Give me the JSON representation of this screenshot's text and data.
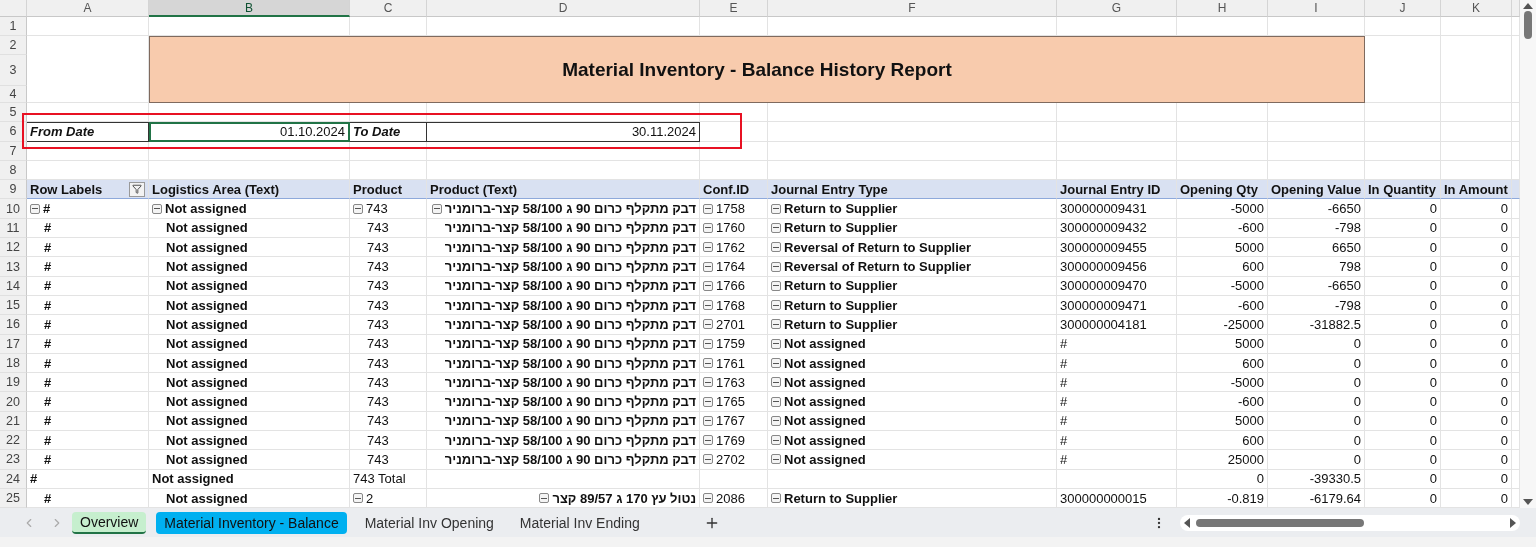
{
  "columns": [
    {
      "label": "A",
      "selected": false
    },
    {
      "label": "B",
      "selected": true
    },
    {
      "label": "C",
      "selected": false
    },
    {
      "label": "D",
      "selected": false
    },
    {
      "label": "E",
      "selected": false
    },
    {
      "label": "F",
      "selected": false
    },
    {
      "label": "G",
      "selected": false
    },
    {
      "label": "H",
      "selected": false
    },
    {
      "label": "I",
      "selected": false
    },
    {
      "label": "J",
      "selected": false
    },
    {
      "label": "K",
      "selected": false
    }
  ],
  "top_row_numbers": [
    "1",
    "2",
    "3",
    "4",
    "5",
    "6",
    "7",
    "8"
  ],
  "title": "Material Inventory - Balance History Report",
  "date_filter": {
    "highlighted": true,
    "from_label": "From Date",
    "from_value": "01.10.2024",
    "from_selected": true,
    "to_label": "To Date",
    "to_value": "30.11.2024"
  },
  "pivot": {
    "header_row_number": "9",
    "headers": [
      "Row Labels",
      "Logistics Area (Text)",
      "Product",
      "Product (Text)",
      "Conf.ID",
      "Journal Entry Type",
      "Journal Entry ID",
      "Opening Qty",
      "Opening Value",
      "In Quantity",
      "In Amount"
    ],
    "rows": [
      {
        "num": "10",
        "kind": "detail",
        "cells": [
          {
            "text": "#",
            "expanded": true
          },
          {
            "text": "Not assigned",
            "expanded": true
          },
          {
            "text": "743",
            "expanded": true
          },
          {
            "text": "דבק מתקלף כרום 90 ג 58/100 קצר-ברומניר",
            "expanded": true
          },
          {
            "text": "1758",
            "expanded": true
          },
          {
            "text": "Return to Supplier",
            "expanded": true
          },
          "300000009431",
          "-5000",
          "-6650",
          "0",
          "0"
        ]
      },
      {
        "num": "11",
        "kind": "detail",
        "cells": [
          "#",
          "Not assigned",
          "743",
          "דבק מתקלף כרום 90 ג 58/100 קצר-ברומניר",
          {
            "text": "1760",
            "expanded": true
          },
          {
            "text": "Return to Supplier",
            "expanded": true
          },
          "300000009432",
          "-600",
          "-798",
          "0",
          "0"
        ]
      },
      {
        "num": "12",
        "kind": "detail",
        "cells": [
          "#",
          "Not assigned",
          "743",
          "דבק מתקלף כרום 90 ג 58/100 קצר-ברומניר",
          {
            "text": "1762",
            "expanded": true
          },
          {
            "text": "Reversal of Return to Supplier",
            "expanded": true
          },
          "300000009455",
          "5000",
          "6650",
          "0",
          "0"
        ]
      },
      {
        "num": "13",
        "kind": "detail",
        "cells": [
          "#",
          "Not assigned",
          "743",
          "דבק מתקלף כרום 90 ג 58/100 קצר-ברומניר",
          {
            "text": "1764",
            "expanded": true
          },
          {
            "text": "Reversal of Return to Supplier",
            "expanded": true
          },
          "300000009456",
          "600",
          "798",
          "0",
          "0"
        ]
      },
      {
        "num": "14",
        "kind": "detail",
        "cells": [
          "#",
          "Not assigned",
          "743",
          "דבק מתקלף כרום 90 ג 58/100 קצר-ברומניר",
          {
            "text": "1766",
            "expanded": true
          },
          {
            "text": "Return to Supplier",
            "expanded": true
          },
          "300000009470",
          "-5000",
          "-6650",
          "0",
          "0"
        ]
      },
      {
        "num": "15",
        "kind": "detail",
        "cells": [
          "#",
          "Not assigned",
          "743",
          "דבק מתקלף כרום 90 ג 58/100 קצר-ברומניר",
          {
            "text": "1768",
            "expanded": true
          },
          {
            "text": "Return to Supplier",
            "expanded": true
          },
          "300000009471",
          "-600",
          "-798",
          "0",
          "0"
        ]
      },
      {
        "num": "16",
        "kind": "detail",
        "cells": [
          "#",
          "Not assigned",
          "743",
          "דבק מתקלף כרום 90 ג 58/100 קצר-ברומניר",
          {
            "text": "2701",
            "expanded": true
          },
          {
            "text": "Return to Supplier",
            "expanded": true
          },
          "300000004181",
          "-25000",
          "-31882.5",
          "0",
          "0"
        ]
      },
      {
        "num": "17",
        "kind": "detail",
        "cells": [
          "#",
          "Not assigned",
          "743",
          "דבק מתקלף כרום 90 ג 58/100 קצר-ברומניר",
          {
            "text": "1759",
            "expanded": true
          },
          {
            "text": "Not assigned",
            "expanded": true
          },
          "#",
          "5000",
          "0",
          "0",
          "0"
        ]
      },
      {
        "num": "18",
        "kind": "detail",
        "cells": [
          "#",
          "Not assigned",
          "743",
          "דבק מתקלף כרום 90 ג 58/100 קצר-ברומניר",
          {
            "text": "1761",
            "expanded": true
          },
          {
            "text": "Not assigned",
            "expanded": true
          },
          "#",
          "600",
          "0",
          "0",
          "0"
        ]
      },
      {
        "num": "19",
        "kind": "detail",
        "cells": [
          "#",
          "Not assigned",
          "743",
          "דבק מתקלף כרום 90 ג 58/100 קצר-ברומניר",
          {
            "text": "1763",
            "expanded": true
          },
          {
            "text": "Not assigned",
            "expanded": true
          },
          "#",
          "-5000",
          "0",
          "0",
          "0"
        ]
      },
      {
        "num": "20",
        "kind": "detail",
        "cells": [
          "#",
          "Not assigned",
          "743",
          "דבק מתקלף כרום 90 ג 58/100 קצר-ברומניר",
          {
            "text": "1765",
            "expanded": true
          },
          {
            "text": "Not assigned",
            "expanded": true
          },
          "#",
          "-600",
          "0",
          "0",
          "0"
        ]
      },
      {
        "num": "21",
        "kind": "detail",
        "cells": [
          "#",
          "Not assigned",
          "743",
          "דבק מתקלף כרום 90 ג 58/100 קצר-ברומניר",
          {
            "text": "1767",
            "expanded": true
          },
          {
            "text": "Not assigned",
            "expanded": true
          },
          "#",
          "5000",
          "0",
          "0",
          "0"
        ]
      },
      {
        "num": "22",
        "kind": "detail",
        "cells": [
          "#",
          "Not assigned",
          "743",
          "דבק מתקלף כרום 90 ג 58/100 קצר-ברומניר",
          {
            "text": "1769",
            "expanded": true
          },
          {
            "text": "Not assigned",
            "expanded": true
          },
          "#",
          "600",
          "0",
          "0",
          "0"
        ]
      },
      {
        "num": "23",
        "kind": "detail",
        "cells": [
          "#",
          "Not assigned",
          "743",
          "דבק מתקלף כרום 90 ג 58/100 קצר-ברומניר",
          {
            "text": "2702",
            "expanded": true
          },
          {
            "text": "Not assigned",
            "expanded": true
          },
          "#",
          "25000",
          "0",
          "0",
          "0"
        ]
      },
      {
        "num": "24",
        "kind": "subtotal",
        "cells": [
          "#",
          "Not assigned",
          "743 Total",
          null,
          null,
          null,
          null,
          "0",
          "-39330.5",
          "0",
          "0"
        ]
      },
      {
        "num": "25",
        "kind": "detail",
        "cells": [
          "#",
          "Not assigned",
          {
            "text": "2",
            "expanded": true
          },
          {
            "text": "נטול עץ 170 ג 89/57 קצר",
            "expanded": true
          },
          {
            "text": "2086",
            "expanded": true
          },
          {
            "text": "Return to Supplier",
            "expanded": true
          },
          "300000000015",
          "-0.819",
          "-6179.64",
          "0",
          "0"
        ]
      }
    ]
  },
  "sheet_tabs": [
    {
      "label": "Overview",
      "selected": true,
      "color": "#c6efce"
    },
    {
      "label": "Material Inventory - Balance",
      "selected": false,
      "color": "#00b0f0"
    },
    {
      "label": "Material Inv Opening",
      "selected": false
    },
    {
      "label": "Material Inv Ending",
      "selected": false
    }
  ]
}
